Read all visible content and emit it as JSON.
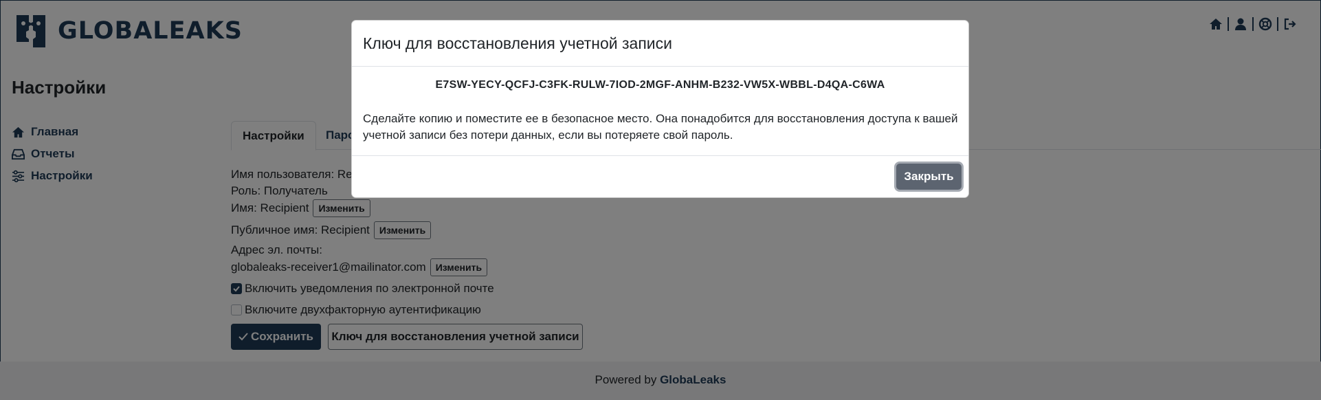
{
  "header": {
    "logo_text": "GLOBALEAKS",
    "icons": [
      "home-icon",
      "user-icon",
      "support-icon",
      "logout-icon"
    ]
  },
  "page": {
    "title": "Настройки"
  },
  "sidebar": {
    "items": [
      {
        "label": "Главная",
        "icon": "home-icon"
      },
      {
        "label": "Отчеты",
        "icon": "inbox-icon"
      },
      {
        "label": "Настройки",
        "icon": "sliders-icon"
      }
    ]
  },
  "tabs": [
    {
      "label": "Настройки",
      "active": true
    },
    {
      "label": "Паро",
      "active": false
    }
  ],
  "profile": {
    "username_label": "Имя пользователя: Rec",
    "role_label": "Роль: Получатель",
    "name_label": "Имя: Recipient",
    "public_name_label": "Публичное имя: Recipient",
    "email_label": "Адрес эл. почты:",
    "email_value": "globaleaks-receiver1@mailinator.com",
    "change_label": "Изменить",
    "email_notifications_label": "Включить уведомления по электронной почте",
    "email_notifications_checked": true,
    "two_factor_label": "Включите двухфакторную аутентификацию",
    "two_factor_checked": false,
    "save_label": "Сохранить",
    "recovery_key_button_label": "Ключ для восстановления учетной записи"
  },
  "footer": {
    "prefix": "Powered by",
    "brand": "GlobaLeaks"
  },
  "modal": {
    "title": "Ключ для восстановления учетной записи",
    "key": "E7SW-YECY-QCFJ-C3FK-RULW-7IOD-2MGF-ANHM-B232-VW5X-WBBL-D4QA-C6WA",
    "note": "Сделайте копию и поместите ее в безопасное место. Она понадобится для восстановления доступа к вашей учетной записи без потери данных, если вы потеряете свой пароль.",
    "close_label": "Закрыть"
  },
  "colors": {
    "brand": "#1f3b57",
    "close_button": "#5c6470",
    "footer_bg": "#f0f1f2"
  }
}
